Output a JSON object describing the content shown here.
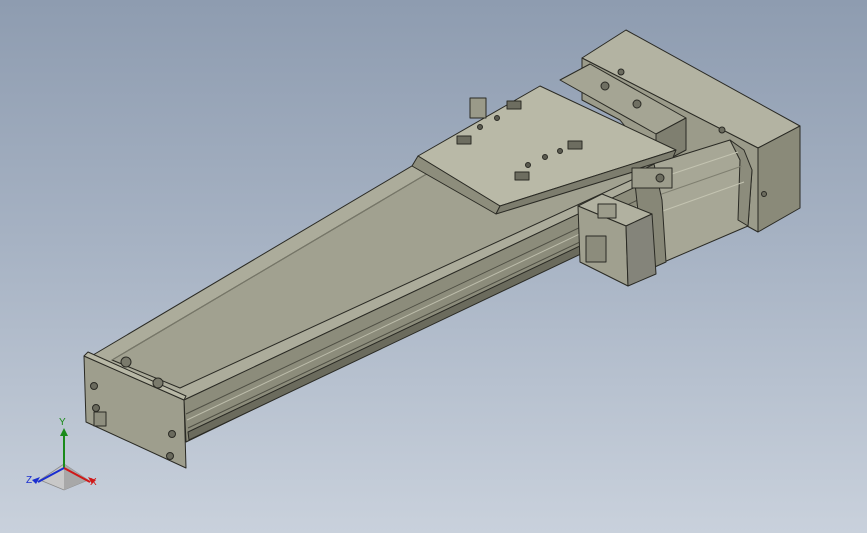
{
  "axes": {
    "x_label": "X",
    "y_label": "Y",
    "z_label": "Z",
    "x_color": "#d01818",
    "y_color": "#1a8a1a",
    "z_color": "#1a2ed0"
  },
  "colors": {
    "body_light": "#a8a897",
    "body_mid": "#8f8f7e",
    "body_dark": "#5e5e52",
    "edge": "#2a2a24"
  }
}
